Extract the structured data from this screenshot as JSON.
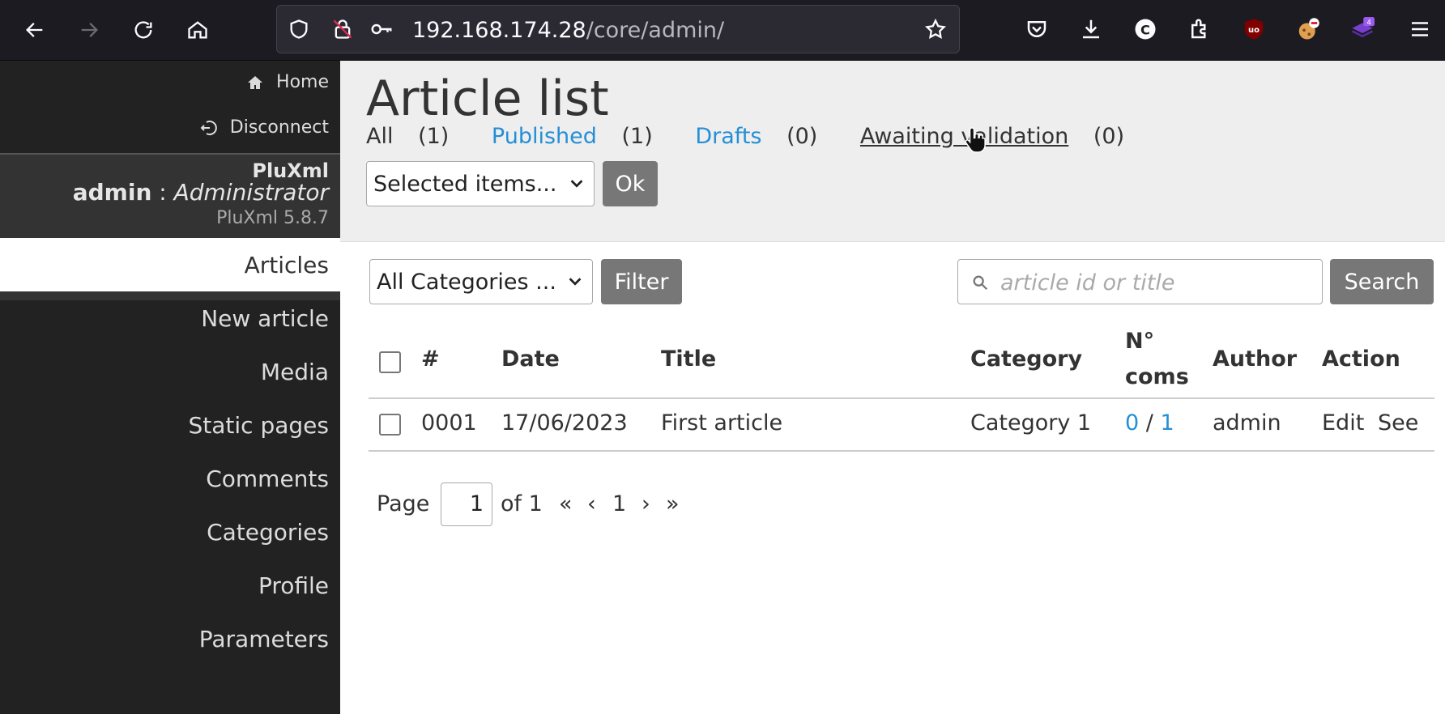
{
  "browser": {
    "url_host": "192.168.174.28",
    "url_path": "/core/admin/",
    "extension_badge": "4"
  },
  "sidebar": {
    "home_label": "Home",
    "disconnect_label": "Disconnect",
    "brand": "PluXml",
    "user_name": "admin",
    "user_sep": " : ",
    "user_role": "Administrator",
    "version": "PluXml 5.8.7",
    "menu": [
      {
        "label": "Articles",
        "active": true
      },
      {
        "label": "New article"
      },
      {
        "label": "Media"
      },
      {
        "label": "Static pages"
      },
      {
        "label": "Comments"
      },
      {
        "label": "Categories"
      },
      {
        "label": "Profile"
      },
      {
        "label": "Parameters"
      }
    ]
  },
  "header": {
    "title": "Article list",
    "filters": {
      "all_label": "All",
      "all_count": "(1)",
      "published_label": "Published",
      "published_count": "(1)",
      "drafts_label": "Drafts",
      "drafts_count": "(0)",
      "awaiting_label": "Awaiting validation",
      "awaiting_count": "(0)"
    },
    "bulk_select": "Selected items...",
    "ok_label": "Ok"
  },
  "toolbar": {
    "category_select": "All Categories ...",
    "filter_label": "Filter",
    "search_placeholder": "article id or title",
    "search_label": "Search"
  },
  "table": {
    "columns": [
      "#",
      "Date",
      "Title",
      "Category",
      "N°",
      "coms",
      "Author",
      "Action"
    ],
    "rows": [
      {
        "id": "0001",
        "date": "17/06/2023",
        "title": "First article",
        "category": "Category 1",
        "coms_a": "0",
        "coms_sep": " / ",
        "coms_b": "1",
        "author": "admin",
        "edit": "Edit",
        "see": "See"
      }
    ]
  },
  "pagination": {
    "page_label": "Page",
    "page_value": "1",
    "of_label": "of 1",
    "first": "«",
    "prev": "‹",
    "current": "1",
    "next": "›",
    "last": "»"
  },
  "colors": {
    "link": "#258fd6",
    "sidebar_bg": "#222222",
    "header_bg": "#eeeeee",
    "button_grey": "#777777"
  }
}
